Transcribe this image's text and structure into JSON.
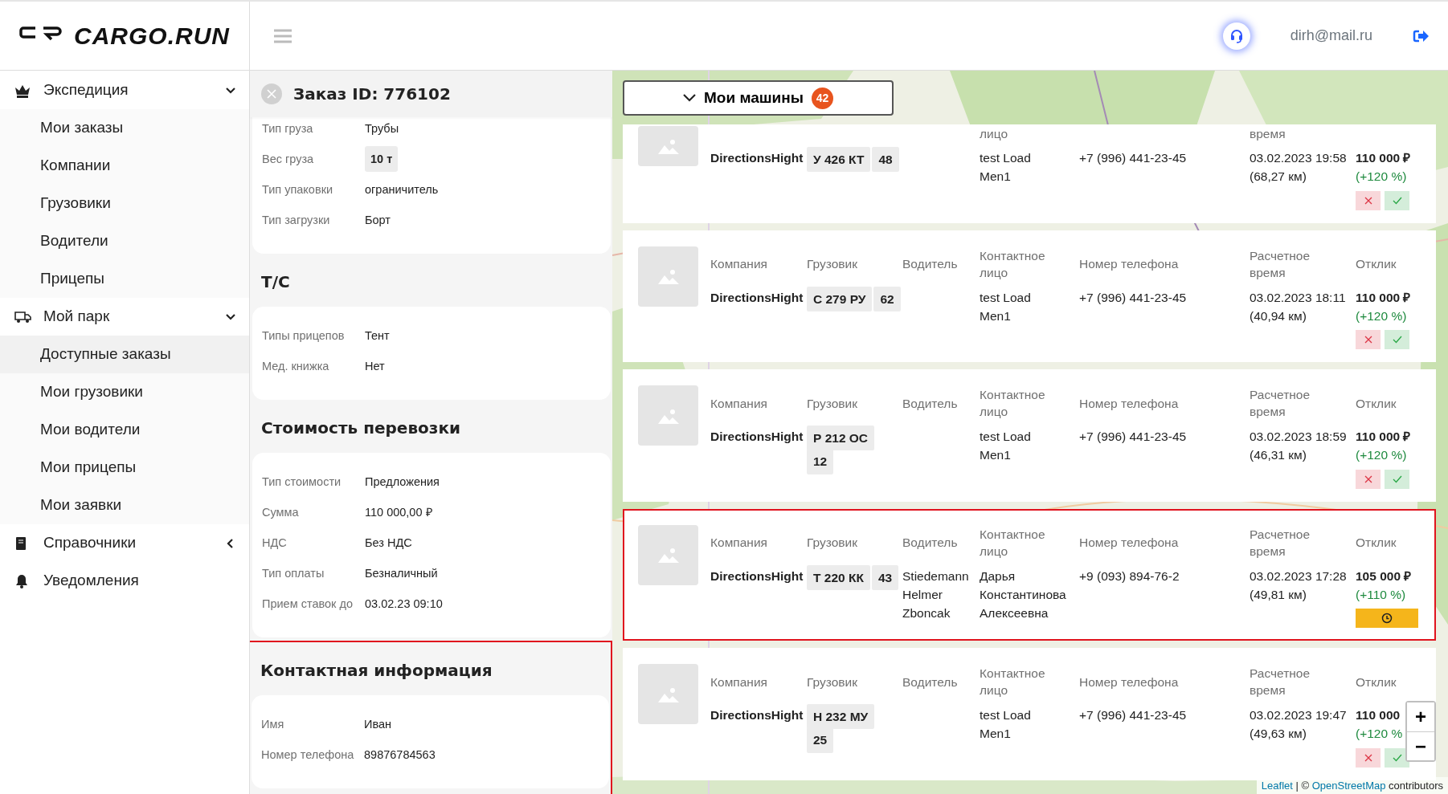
{
  "header": {
    "logo": "CARGO.RUN",
    "email": "dirh@mail.ru"
  },
  "sidebar": [
    {
      "kind": "group",
      "label": "Экспедиция",
      "expanded": true,
      "children": [
        {
          "label": "Мои заказы",
          "selected": false
        },
        {
          "label": "Компании",
          "selected": false
        },
        {
          "label": "Грузовики",
          "selected": false
        },
        {
          "label": "Водители",
          "selected": false
        },
        {
          "label": "Прицепы",
          "selected": false
        }
      ]
    },
    {
      "kind": "group",
      "label": "Мой парк",
      "expanded": true,
      "children": [
        {
          "label": "Доступные заказы",
          "selected": true
        },
        {
          "label": "Мои грузовики",
          "selected": false
        },
        {
          "label": "Мои водители",
          "selected": false
        },
        {
          "label": "Мои прицепы",
          "selected": false
        },
        {
          "label": "Мои заявки",
          "selected": false
        }
      ]
    },
    {
      "kind": "group",
      "label": "Справочники",
      "expanded": false
    },
    {
      "kind": "link",
      "label": "Уведомления"
    }
  ],
  "order": {
    "title": "Заказ ID: 776102",
    "sections": [
      {
        "highlighted": false,
        "rows": [
          {
            "label": "Тип груза",
            "value": "Трубы",
            "kind": "text"
          },
          {
            "label": "Вес груза",
            "value": "10 т",
            "kind": "badge"
          },
          {
            "label": "Тип упаковки",
            "value": "ограничитель",
            "kind": "text"
          },
          {
            "label": "Тип загрузки",
            "value": "Борт",
            "kind": "text"
          }
        ]
      },
      {
        "title": "Т/С",
        "highlighted": false,
        "rows": [
          {
            "label": "Типы прицепов",
            "value": "Тент",
            "kind": "text"
          },
          {
            "label": "Мед. книжка",
            "value": "Нет",
            "kind": "text"
          }
        ]
      },
      {
        "title": "Стоимость перевозки",
        "highlighted": false,
        "rows": [
          {
            "label": "Тип стоимости",
            "value": "Предложения",
            "kind": "text"
          },
          {
            "label": "Сумма",
            "value": "110 000,00 ₽",
            "kind": "text"
          },
          {
            "label": "НДС",
            "value": "Без НДС",
            "kind": "text"
          },
          {
            "label": "Тип оплаты",
            "value": "Безналичный",
            "kind": "text"
          },
          {
            "label": "Прием ставок до",
            "value": "03.02.23 09:10",
            "kind": "text"
          }
        ]
      },
      {
        "title": "Контактная информация",
        "highlighted": true,
        "rows": [
          {
            "label": "Имя",
            "value": "Иван",
            "kind": "text"
          },
          {
            "label": "Номер телефона",
            "value": "89876784563",
            "kind": "text"
          }
        ]
      }
    ]
  },
  "map": {
    "button": {
      "label": "Мои машины",
      "count": "42",
      "expanded": true
    },
    "cards": [
      {
        "highlighted": false,
        "labels": {
          "contact": "лицо",
          "time": "время"
        },
        "company": "DirectionsHight",
        "plate": "У 426 КТ",
        "region": "48",
        "contact": "test Load Men1",
        "phone": "+7 (996) 441-23-45",
        "time": "03.02.2023 19:58",
        "distance": "(68,27 км)",
        "price": "110 000 ₽",
        "percent": "(+120 %)",
        "kind": "actions"
      },
      {
        "highlighted": false,
        "labels": {
          "company": "Компания",
          "truck": "Грузовик",
          "driver": "Водитель",
          "contact": "Контактное лицо",
          "phone": "Номер телефона",
          "time": "Расчетное время",
          "response": "Отклик"
        },
        "company": "DirectionsHight",
        "plate": "С 279 РУ",
        "region": "62",
        "contact": "test Load Men1",
        "phone": "+7 (996) 441-23-45",
        "time": "03.02.2023 18:11",
        "distance": "(40,94 км)",
        "price": "110 000 ₽",
        "percent": "(+120 %)",
        "kind": "actions"
      },
      {
        "highlighted": false,
        "labels": {
          "company": "Компания",
          "truck": "Грузовик",
          "driver": "Водитель",
          "contact": "Контактное лицо",
          "phone": "Номер телефона",
          "time": "Расчетное время",
          "response": "Отклик"
        },
        "company": "DirectionsHight",
        "plate": "Р 212 ОС",
        "region": "12",
        "contact": "test Load Men1",
        "phone": "+7 (996) 441-23-45",
        "time": "03.02.2023 18:59",
        "distance": "(46,31 км)",
        "price": "110 000 ₽",
        "percent": "(+120 %)",
        "kind": "actions"
      },
      {
        "highlighted": true,
        "labels": {
          "company": "Компания",
          "truck": "Грузовик",
          "driver": "Водитель",
          "contact": "Контактное лицо",
          "phone": "Номер телефона",
          "time": "Расчетное время",
          "response": "Отклик"
        },
        "company": "DirectionsHight",
        "plate": "Т 220 КК",
        "region": "43",
        "driver": "Stiedemann Helmer Zboncak",
        "contact": "Дарья Константинова Алексеевна",
        "phone": "+9 (093) 894-76-2",
        "time": "03.02.2023 17:28",
        "distance": "(49,81 км)",
        "price": "105 000 ₽",
        "percent": "(+110 %)",
        "kind": "pending"
      },
      {
        "highlighted": false,
        "labels": {
          "company": "Компания",
          "truck": "Грузовик",
          "driver": "Водитель",
          "contact": "Контактное лицо",
          "phone": "Номер телефона",
          "time": "Расчетное время",
          "response": "Отклик"
        },
        "company": "DirectionsHight",
        "plate": "Н 232 МУ",
        "region": "25",
        "contact": "test Load Men1",
        "phone": "+7 (996) 441-23-45",
        "time": "03.02.2023 19:47",
        "distance": "(49,63 км)",
        "price": "110 000",
        "percent": "(+120 %",
        "kind": "actions"
      }
    ],
    "zoom": [
      "+",
      "−"
    ],
    "attribution": {
      "link1": "Leaflet",
      "sep": "| ©",
      "link2": "OpenStreetMap",
      "tail": "contributors"
    }
  }
}
